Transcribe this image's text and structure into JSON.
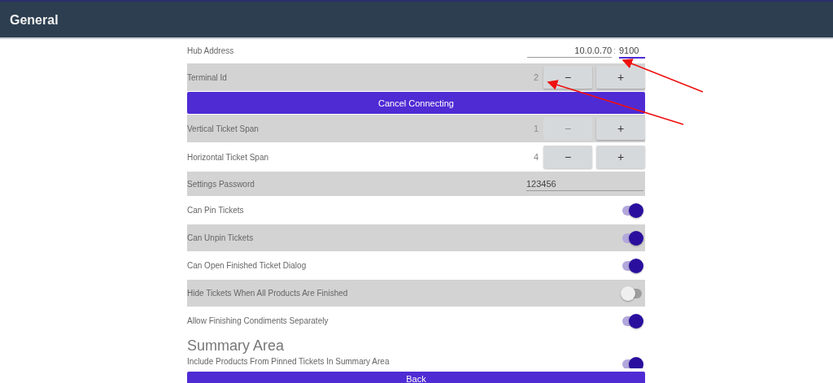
{
  "app_bar": {
    "title": "General"
  },
  "rows": [
    {
      "kind": "address",
      "label": "Hub Address",
      "host": "10.0.0.70",
      "separator": ":",
      "port": "9100",
      "port_focused": true
    },
    {
      "kind": "stepper",
      "label": "Terminal Id",
      "value": "2",
      "minus": "−",
      "plus": "+",
      "minus_disabled": false
    },
    {
      "kind": "button",
      "label": "Cancel Connecting"
    },
    {
      "kind": "stepper",
      "label": "Vertical Ticket Span",
      "value": "1",
      "minus": "−",
      "plus": "+",
      "minus_disabled": true
    },
    {
      "kind": "stepper",
      "label": "Horizontal Ticket Span",
      "value": "4",
      "minus": "−",
      "plus": "+",
      "minus_disabled": false
    },
    {
      "kind": "password",
      "label": "Settings Password",
      "value": "123456"
    },
    {
      "kind": "toggle",
      "label": "Can Pin Tickets",
      "on": true
    },
    {
      "kind": "toggle",
      "label": "Can Unpin Tickets",
      "on": true
    },
    {
      "kind": "toggle",
      "label": "Can Open Finished Ticket Dialog",
      "on": true
    },
    {
      "kind": "toggle",
      "label": "Hide Tickets When All Products Are Finished",
      "on": false
    },
    {
      "kind": "toggle",
      "label": "Allow Finishing Condiments Separately",
      "on": true
    },
    {
      "kind": "heading",
      "label": "Summary Area"
    },
    {
      "kind": "toggle",
      "label": "Include Products From Pinned Tickets In Summary Area",
      "on": true
    }
  ],
  "back_button": {
    "label": "Back"
  }
}
